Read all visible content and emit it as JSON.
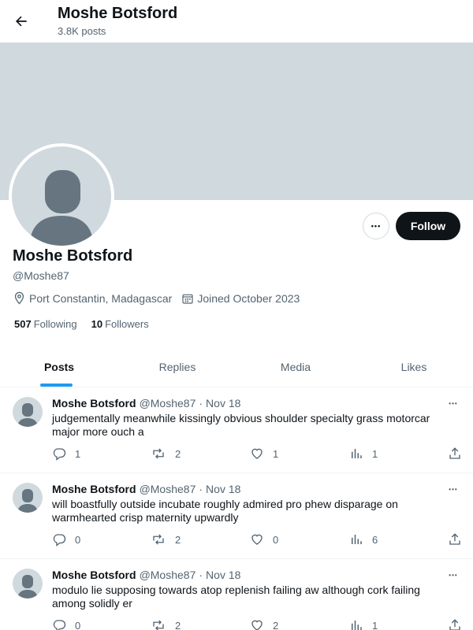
{
  "header": {
    "title": "Moshe Botsford",
    "posts_count": "3.8K posts"
  },
  "profile": {
    "name": "Moshe Botsford",
    "handle": "@Moshe87",
    "location": "Port Constantin, Madagascar",
    "joined": "Joined October 2023",
    "following_count": "507",
    "following_label": "Following",
    "followers_count": "10",
    "followers_label": "Followers",
    "follow_label": "Follow",
    "more_label": "•••"
  },
  "tabs": [
    {
      "label": "Posts",
      "active": true
    },
    {
      "label": "Replies",
      "active": false
    },
    {
      "label": "Media",
      "active": false
    },
    {
      "label": "Likes",
      "active": false
    }
  ],
  "posts": [
    {
      "name": "Moshe Botsford",
      "handle": "@Moshe87",
      "date": "Nov 18",
      "text": "judgementally meanwhile kissingly obvious shoulder specialty grass motorcar major more ouch a",
      "replies": "1",
      "reposts": "2",
      "likes": "1",
      "views": "1"
    },
    {
      "name": "Moshe Botsford",
      "handle": "@Moshe87",
      "date": "Nov 18",
      "text": "will boastfully outside incubate roughly admired pro phew disparage on warmhearted crisp maternity upwardly",
      "replies": "0",
      "reposts": "2",
      "likes": "0",
      "views": "6"
    },
    {
      "name": "Moshe Botsford",
      "handle": "@Moshe87",
      "date": "Nov 18",
      "text": "modulo lie supposing towards atop replenish failing aw although cork failing among solidly er",
      "replies": "0",
      "reposts": "2",
      "likes": "2",
      "views": "1"
    }
  ],
  "post_separator": "·",
  "colors": {
    "accent": "#1d9bf0",
    "banner": "#cfd9de",
    "text_primary": "#0f1419",
    "text_secondary": "#536471",
    "follow_button": "#0f1419"
  },
  "icons": {
    "back": "arrow-left-icon",
    "location": "map-pin-icon",
    "joined": "calendar-icon",
    "reply": "speech-bubble-icon",
    "repost": "repost-arrows-icon",
    "like": "heart-icon",
    "views": "bar-chart-icon",
    "share": "share-upload-icon"
  }
}
